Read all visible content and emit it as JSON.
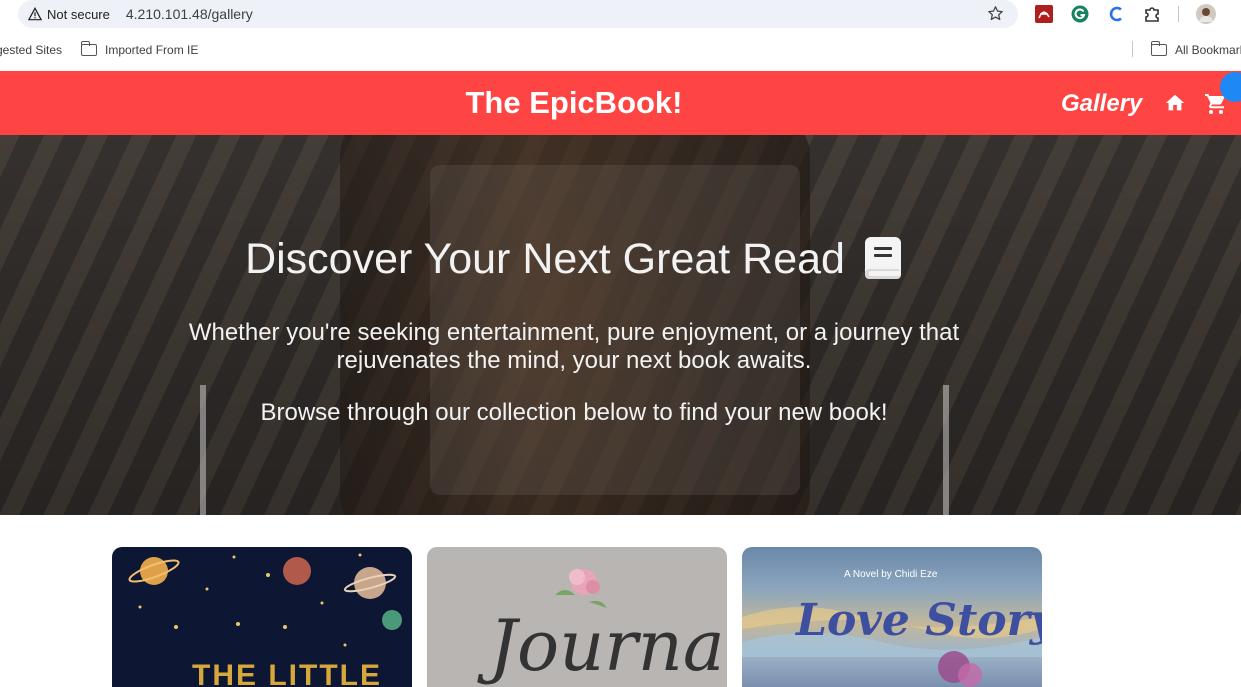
{
  "browser": {
    "security_label": "Not secure",
    "url": "4.210.101.48/gallery",
    "bookmarks": [
      {
        "label": "gested Sites",
        "icon": "globe-icon"
      },
      {
        "label": "Imported From IE",
        "icon": "folder-icon"
      },
      {
        "label": "All Bookmark",
        "icon": "folder-icon"
      }
    ],
    "extensions": [
      "pdf-icon",
      "grammarly-icon",
      "c-icon",
      "puzzle-icon",
      "profile-avatar"
    ]
  },
  "navbar": {
    "brand": "The EpicBook!",
    "gallery_label": "Gallery",
    "home_icon": "home-icon",
    "cart_icon": "cart-icon",
    "color": "#ff4444"
  },
  "hero": {
    "title": "Discover Your Next Great Read",
    "title_icon": "book-icon",
    "subtitle": "Whether you're seeking entertainment, pure enjoyment, or a journey that rejuvenates the mind, your next book awaits.",
    "browse_text": "Browse through our collection below to find your new book!"
  },
  "books": [
    {
      "cover_text": "THE LITTLE",
      "cover_subtext": ""
    },
    {
      "cover_text": "Journal",
      "cover_subtext": ""
    },
    {
      "cover_text": "Love Story",
      "cover_subtext": "A Novel by Chidi Eze"
    }
  ]
}
